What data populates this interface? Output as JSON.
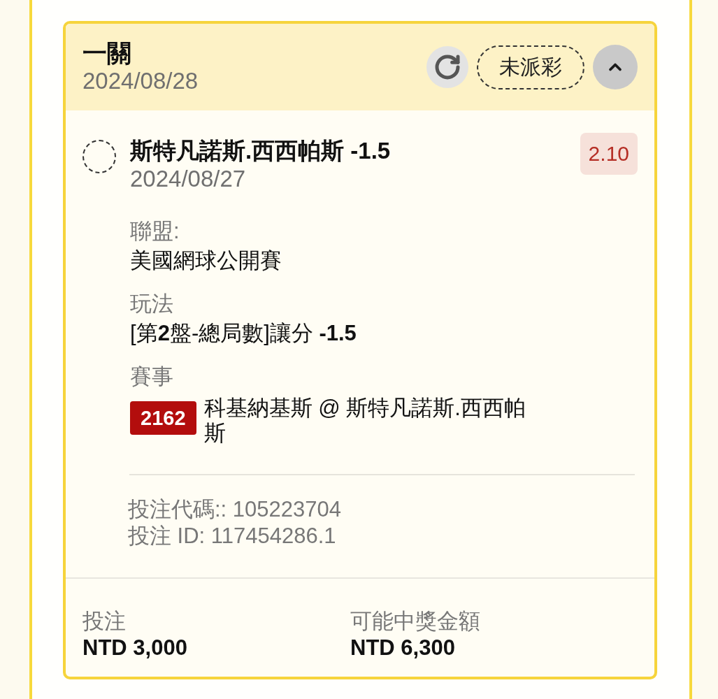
{
  "bet": {
    "type": "一關",
    "date": "2024/08/28",
    "status": "未派彩",
    "expanded": true
  },
  "selection": {
    "selected": false,
    "name": "斯特凡諾斯.西西帕斯 -1.5",
    "date": "2024/08/27",
    "odds": "2.10"
  },
  "details": [
    {
      "kind": "text",
      "label": "聯盟:",
      "value": "美國網球公開賽"
    },
    {
      "kind": "text",
      "label": "玩法",
      "value": "[第**2**盤-總局數]讓分 **-1.5**"
    },
    {
      "kind": "event",
      "label": "賽事",
      "badge": "2162",
      "value": "科基納基斯 @ 斯特凡諾斯.西西帕斯"
    }
  ],
  "codes": [
    "投注代碼:: 105223704",
    "投注 ID: 117454286.1"
  ],
  "summary": [
    {
      "label": "投注",
      "value": "NTD 3,000"
    },
    {
      "label": "可能中獎金額",
      "value": "NTD 6,300"
    }
  ]
}
